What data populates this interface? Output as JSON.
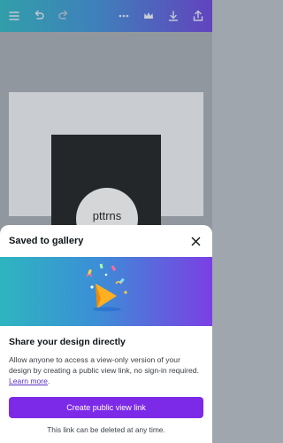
{
  "toolbar": {
    "icons": [
      "menu-icon",
      "undo-icon",
      "redo-icon",
      "more-icon",
      "crown-icon",
      "download-icon",
      "share-icon"
    ]
  },
  "canvas": {
    "design_text": "pttrns"
  },
  "sheet": {
    "title": "Saved to gallery",
    "headline": "Share your design directly",
    "description": "Allow anyone to access a view-only version of your design by creating a public view link, no sign-in required.",
    "learn_more": "Learn more",
    "button_label": "Create public view link",
    "note": "This link can be deleted at any time."
  },
  "colors": {
    "brand_purple": "#7d2ae8",
    "gradient_start": "#2eb5c0",
    "gradient_end": "#7b3fe4"
  }
}
